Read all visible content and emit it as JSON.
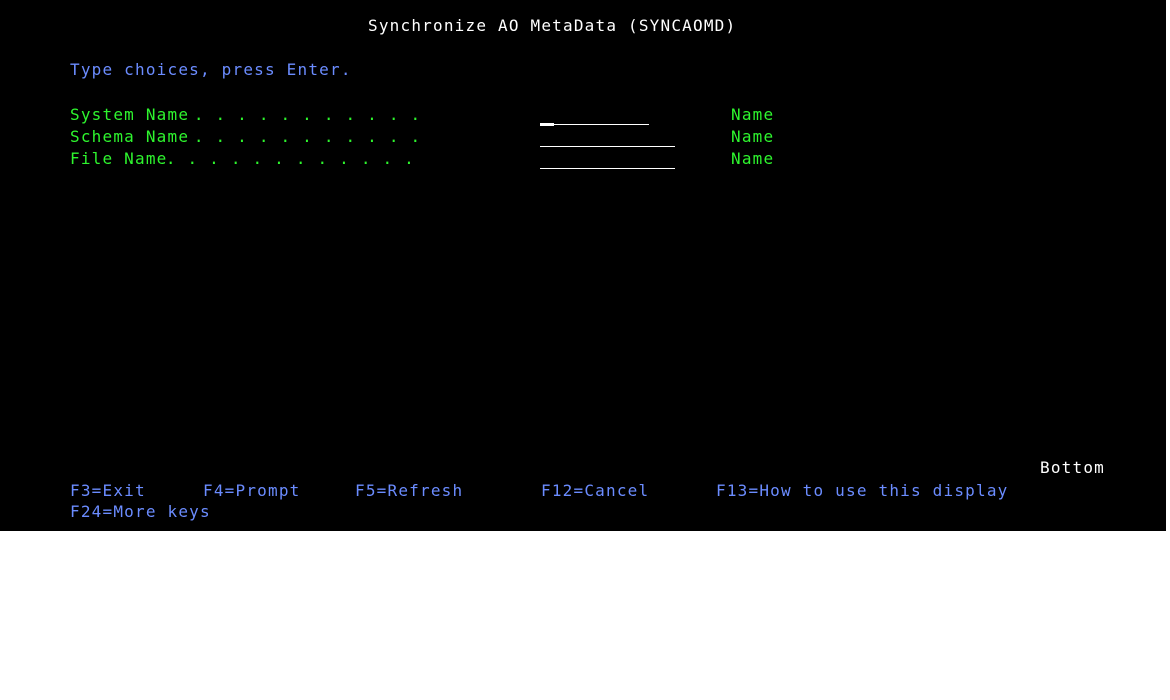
{
  "screen": {
    "title": "Synchronize AO MetaData (SYNCAOMD)",
    "instruction": "Type choices, press Enter.",
    "fields": [
      {
        "label": "System Name",
        "dots": " . . . . . . . . . . .",
        "value": "",
        "hint": "Name"
      },
      {
        "label": "Schema Name",
        "dots": " . . . . . . . . . . .",
        "value": "",
        "hint": "Name"
      },
      {
        "label": "File Name",
        "dots": " . . . . . . . . . . . .",
        "value": "",
        "hint": "Name"
      }
    ],
    "more_indicator": "Bottom",
    "function_keys": [
      "F3=Exit",
      "F4=Prompt",
      "F5=Refresh",
      "F12=Cancel",
      "F13=How to use this display",
      "F24=More keys"
    ]
  },
  "colors": {
    "background": "#000000",
    "title": "#ffffff",
    "instruction": "#6b8cff",
    "field_text": "#2ef52e"
  }
}
